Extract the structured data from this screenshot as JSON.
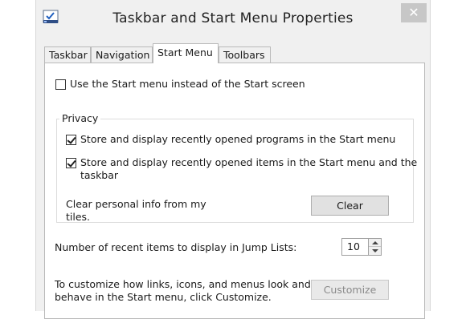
{
  "window": {
    "title": "Taskbar and Start Menu Properties",
    "close_glyph": "✕"
  },
  "tabs": [
    {
      "label": "Taskbar"
    },
    {
      "label": "Navigation"
    },
    {
      "label": "Start Menu",
      "active": true
    },
    {
      "label": "Toolbars"
    }
  ],
  "start_menu": {
    "use_start_menu": {
      "label": "Use the Start menu instead of the Start screen",
      "checked": false
    },
    "privacy": {
      "title": "Privacy",
      "store_programs": {
        "label": "Store and display recently opened programs in the Start menu",
        "checked": true
      },
      "store_items": {
        "label_line1": "Store and display recently opened items in the Start menu and the",
        "label_line2": "taskbar",
        "checked": true
      },
      "clear_info": {
        "label_line1": "Clear personal info from my",
        "label_line2": "tiles.",
        "button": "Clear"
      }
    },
    "jump_lists": {
      "label": "Number of recent items to display in Jump Lists:",
      "value": "10"
    },
    "customize": {
      "label_line1": "To customize how links, icons, and menus look and",
      "label_line2": "behave in the Start menu, click Customize.",
      "button": "Customize",
      "enabled": false
    }
  },
  "colors": {
    "window_bg": "#f0f0f0",
    "panel_bg": "#ffffff",
    "close_bg": "#c7c7c7"
  }
}
